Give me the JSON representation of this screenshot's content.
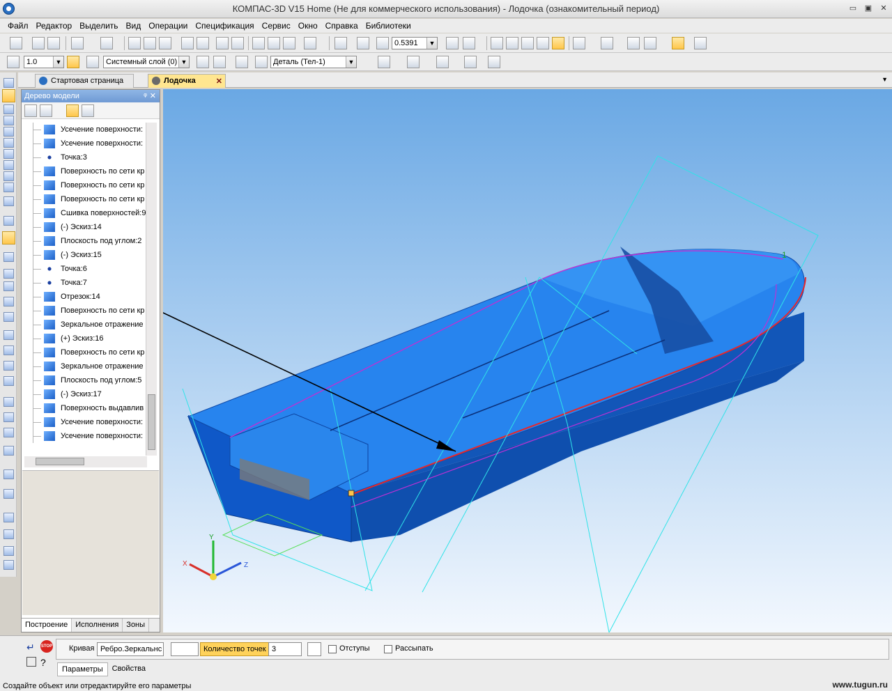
{
  "window": {
    "title": "КОМПАС-3D V15 Home (Не для коммерческого использования) - Лодочка (ознакомительный период)",
    "controls": [
      "▭",
      "▣",
      "✕"
    ]
  },
  "menu": [
    "Файл",
    "Редактор",
    "Выделить",
    "Вид",
    "Операции",
    "Спецификация",
    "Сервис",
    "Окно",
    "Справка",
    "Библиотеки"
  ],
  "toolbar1": {
    "zoom_value": "0.5391"
  },
  "toolbar2": {
    "step_value": "1.0",
    "layer_value": "Системный слой (0)",
    "part_value": "Деталь (Тел-1)"
  },
  "tabs": [
    {
      "label": "Стартовая страница",
      "active": false
    },
    {
      "label": "Лодочка",
      "active": true
    }
  ],
  "tabs_close": "✕",
  "tabs_menu": "▼",
  "tree": {
    "header": "Дерево модели",
    "header_pin": "ᵠ",
    "header_close": "✕",
    "items": [
      {
        "label": "Усечение поверхности:",
        "icon": "surface-trim-icon"
      },
      {
        "label": "Усечение поверхности:",
        "icon": "surface-trim-icon"
      },
      {
        "label": "Точка:3",
        "icon": "point-icon"
      },
      {
        "label": "Поверхность по сети кр",
        "icon": "mesh-surface-icon"
      },
      {
        "label": "Поверхность по сети кр",
        "icon": "mesh-surface-icon"
      },
      {
        "label": "Поверхность по сети кр",
        "icon": "mesh-surface-icon"
      },
      {
        "label": "Сшивка поверхностей:9",
        "icon": "sew-surfaces-icon"
      },
      {
        "label": "(-) Эскиз:14",
        "icon": "sketch-icon"
      },
      {
        "label": "Плоскость под углом:2",
        "icon": "plane-icon"
      },
      {
        "label": "(-) Эскиз:15",
        "icon": "sketch-icon"
      },
      {
        "label": "Точка:6",
        "icon": "point-icon"
      },
      {
        "label": "Точка:7",
        "icon": "point-icon"
      },
      {
        "label": "Отрезок:14",
        "icon": "segment-icon"
      },
      {
        "label": "Поверхность по сети кр",
        "icon": "mesh-surface-icon"
      },
      {
        "label": "Зеркальное отражение",
        "icon": "mirror-icon"
      },
      {
        "label": "(+) Эскиз:16",
        "icon": "sketch-icon"
      },
      {
        "label": "Поверхность по сети кр",
        "icon": "mesh-surface-icon"
      },
      {
        "label": "Зеркальное отражение",
        "icon": "mirror-icon"
      },
      {
        "label": "Плоскость под углом:5",
        "icon": "plane-icon"
      },
      {
        "label": "(-) Эскиз:17",
        "icon": "sketch-icon"
      },
      {
        "label": "Поверхность выдавлив",
        "icon": "extrude-surface-icon"
      },
      {
        "label": "Усечение поверхности:",
        "icon": "surface-trim-icon"
      },
      {
        "label": "Усечение поверхности:",
        "icon": "surface-trim-icon"
      }
    ],
    "bottom_tabs": [
      "Построение",
      "Исполнения",
      "Зоны"
    ]
  },
  "viewport": {
    "marker_label": "1",
    "axes": {
      "x": "X",
      "y": "Y",
      "z": "Z"
    }
  },
  "props": {
    "curve_label": "Кривая",
    "curve_value": "Ребро.Зеркальнс",
    "points_label": "Количество точек",
    "points_value": "3",
    "offsets_label": "Отступы",
    "scatter_label": "Рассыпать",
    "stop_label": "STOP",
    "tab_params": "Параметры",
    "tab_props": "Свойства"
  },
  "status": {
    "text": "Создайте объект или отредактируйте его параметры",
    "watermark": "www.tugun.ru"
  },
  "colors": {
    "accent": "#ffc64a",
    "hull": "#1f78e0",
    "edge": "#e8262a",
    "wire": "#2fe3e8",
    "sketch": "#c02fd4"
  }
}
